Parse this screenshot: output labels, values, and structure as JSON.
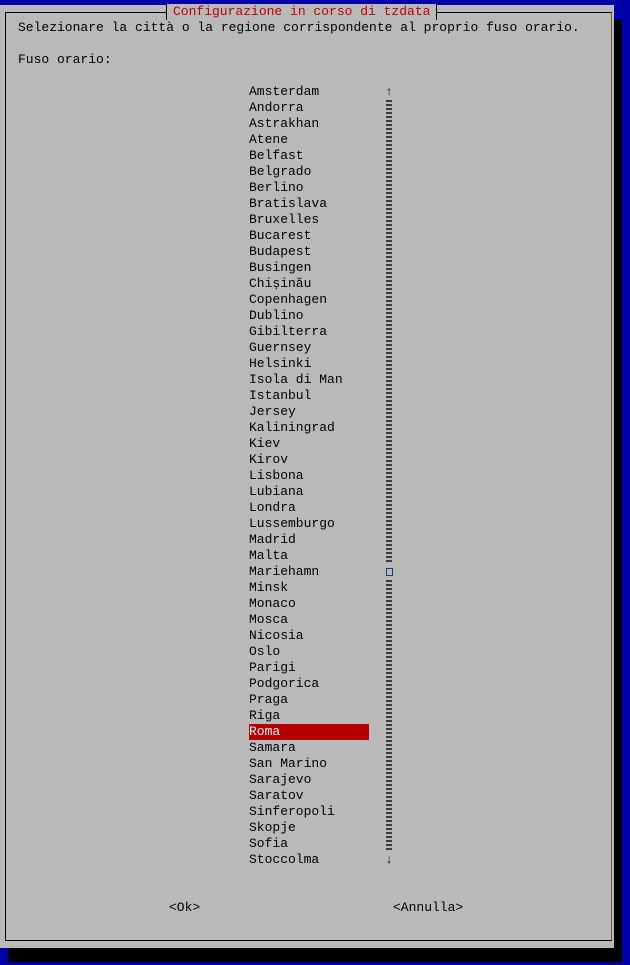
{
  "dialog": {
    "title": "Configurazione in corso di tzdata",
    "prompt": "Selezionare la città o la regione corrispondente al proprio fuso orario.",
    "label": "Fuso orario:",
    "items": [
      "Amsterdam",
      "Andorra",
      "Astrakhan",
      "Atene",
      "Belfast",
      "Belgrado",
      "Berlino",
      "Bratislava",
      "Bruxelles",
      "Bucarest",
      "Budapest",
      "Busingen",
      "Chișinău",
      "Copenhagen",
      "Dublino",
      "Gibilterra",
      "Guernsey",
      "Helsinki",
      "Isola di Man",
      "Istanbul",
      "Jersey",
      "Kaliningrad",
      "Kiev",
      "Kirov",
      "Lisbona",
      "Lubiana",
      "Londra",
      "Lussemburgo",
      "Madrid",
      "Malta",
      "Mariehamn",
      "Minsk",
      "Monaco",
      "Mosca",
      "Nicosia",
      "Oslo",
      "Parigi",
      "Podgorica",
      "Praga",
      "Riga",
      "Roma",
      "Samara",
      "San Marino",
      "Sarajevo",
      "Saratov",
      "Sinferopoli",
      "Skopje",
      "Sofia",
      "Stoccolma"
    ],
    "selected": "Roma",
    "scroll_up": "↑",
    "scroll_down": "↓",
    "ok_label": "<Ok>",
    "cancel_label": "<Annulla>"
  },
  "colors": {
    "background": "#0000a8",
    "dialog": "#b9b9b9",
    "title": "#c00000",
    "selection": "#b40000"
  }
}
